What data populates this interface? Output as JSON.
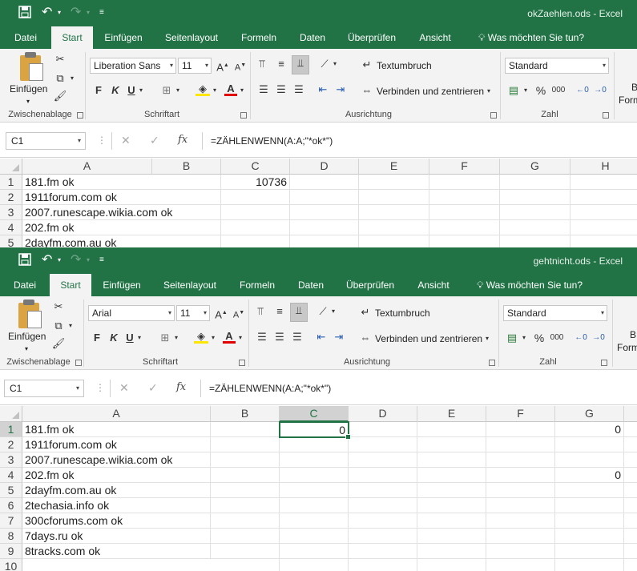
{
  "colors": {
    "accent": "#217346",
    "ribbon_bg": "#f3f3f3",
    "grid_line": "#e1e1e1"
  },
  "windows": [
    {
      "title": "okZaehlen.ods - Excel",
      "tabs": [
        "Datei",
        "Start",
        "Einfügen",
        "Seitenlayout",
        "Formeln",
        "Daten",
        "Überprüfen",
        "Ansicht"
      ],
      "tell_me": "Was möchten Sie tun?",
      "ribbon": {
        "paste_label": "Einfügen",
        "font_name": "Liberation Sans",
        "font_size": "11",
        "wrap_text": "Textumbruch",
        "merge_center": "Verbinden und zentrieren",
        "number_format": "Standard",
        "percent": "%",
        "thousands": "000",
        "bold": "F",
        "italic": "K",
        "underline": "U",
        "groups": [
          "Zwischenablage",
          "Schriftart",
          "Ausrichtung",
          "Zahl"
        ],
        "styles_partial_1": "B",
        "styles_partial_2": "Form"
      },
      "formula_bar": {
        "name_box": "C1",
        "fx": "fx",
        "formula": "=ZÄHLENWENN(A:A;\"*ok*\")"
      },
      "grid": {
        "columns": [
          "A",
          "B",
          "C",
          "D",
          "E",
          "F",
          "G",
          "H"
        ],
        "rows": [
          "1",
          "2",
          "3",
          "4",
          "5"
        ],
        "cells": {
          "A1": "181.fm ok",
          "A2": "1911forum.com ok",
          "A3": "2007.runescape.wikia.com ok",
          "A4": "202.fm ok",
          "A5": "2dayfm.com.au ok",
          "C1": "10736"
        }
      }
    },
    {
      "title": "gehtnicht.ods - Excel",
      "tabs": [
        "Datei",
        "Start",
        "Einfügen",
        "Seitenlayout",
        "Formeln",
        "Daten",
        "Überprüfen",
        "Ansicht"
      ],
      "tell_me": "Was möchten Sie tun?",
      "ribbon": {
        "paste_label": "Einfügen",
        "font_name": "Arial",
        "font_size": "11",
        "wrap_text": "Textumbruch",
        "merge_center": "Verbinden und zentrieren",
        "number_format": "Standard",
        "percent": "%",
        "thousands": "000",
        "bold": "F",
        "italic": "K",
        "underline": "U",
        "groups": [
          "Zwischenablage",
          "Schriftart",
          "Ausrichtung",
          "Zahl"
        ],
        "styles_partial_1": "B",
        "styles_partial_2": "Form"
      },
      "formula_bar": {
        "name_box": "C1",
        "fx": "fx",
        "formula": "=ZÄHLENWENN(A:A;\"*ok*\")"
      },
      "grid": {
        "columns": [
          "A",
          "B",
          "C",
          "D",
          "E",
          "F",
          "G"
        ],
        "rows": [
          "1",
          "2",
          "3",
          "4",
          "5",
          "6",
          "7",
          "8",
          "9",
          "10"
        ],
        "selected_cell": "C1",
        "cells": {
          "A1": "181.fm ok",
          "A2": "1911forum.com ok",
          "A3": "2007.runescape.wikia.com ok",
          "A4": "202.fm ok",
          "A5": "2dayfm.com.au ok",
          "A6": "2techasia.info ok",
          "A7": "300cforums.com ok",
          "A8": "7days.ru ok",
          "A9": "8tracks.com ok",
          "C1": "0",
          "G1": "0",
          "G4": "0"
        }
      }
    }
  ]
}
